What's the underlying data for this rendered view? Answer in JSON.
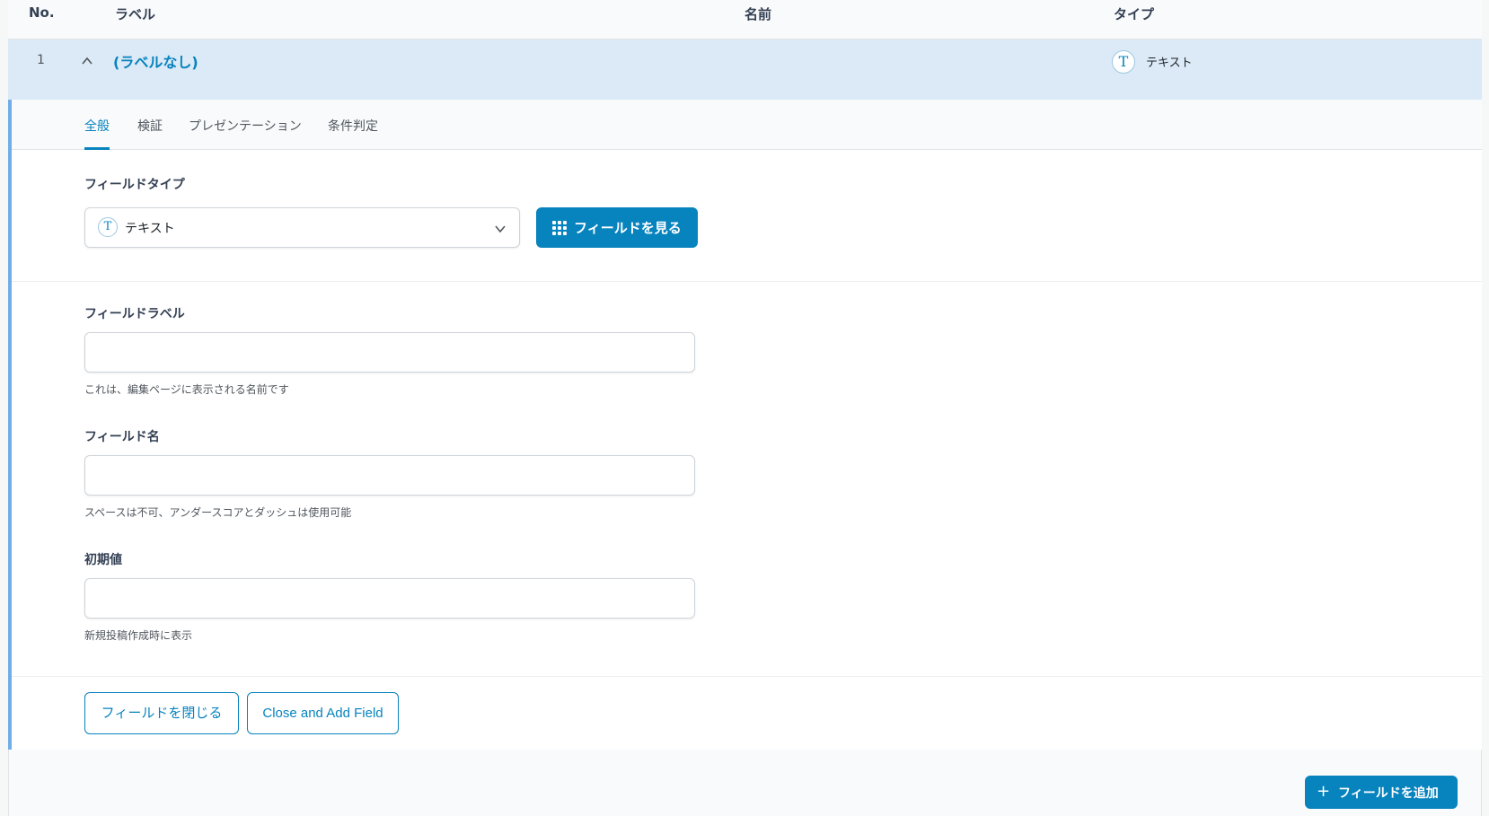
{
  "columns": {
    "no": "No.",
    "label": "ラベル",
    "name": "名前",
    "type": "タイプ"
  },
  "field": {
    "number": "1",
    "label": "(ラベルなし)",
    "type_icon": "T",
    "type": "テキスト"
  },
  "tabs": [
    {
      "label": "全般",
      "active": true
    },
    {
      "label": "検証",
      "active": false
    },
    {
      "label": "プレゼンテーション",
      "active": false
    },
    {
      "label": "条件判定",
      "active": false
    }
  ],
  "field_type": {
    "label": "フィールドタイプ",
    "icon": "T",
    "value": "テキスト",
    "browse_button": "フィールドを見る"
  },
  "field_label": {
    "label": "フィールドラベル",
    "value": "",
    "help": "これは、編集ページに表示される名前です"
  },
  "field_name": {
    "label": "フィールド名",
    "value": "",
    "help": "スペースは不可、アンダースコアとダッシュは使用可能"
  },
  "default_value": {
    "label": "初期値",
    "value": "",
    "help": "新規投稿作成時に表示"
  },
  "actions": {
    "close": "フィールドを閉じる",
    "close_and_add": "Close and Add Field",
    "add_field": "フィールドを追加"
  },
  "icons": {
    "chevron": "chevron-up-icon",
    "select_chevron": "chevron-down-icon",
    "browse": "grid-icon",
    "add": "plus-icon"
  },
  "colors": {
    "accent": "#0783be",
    "row_highlight": "#dbeaf6",
    "left_border": "#72aee6"
  }
}
